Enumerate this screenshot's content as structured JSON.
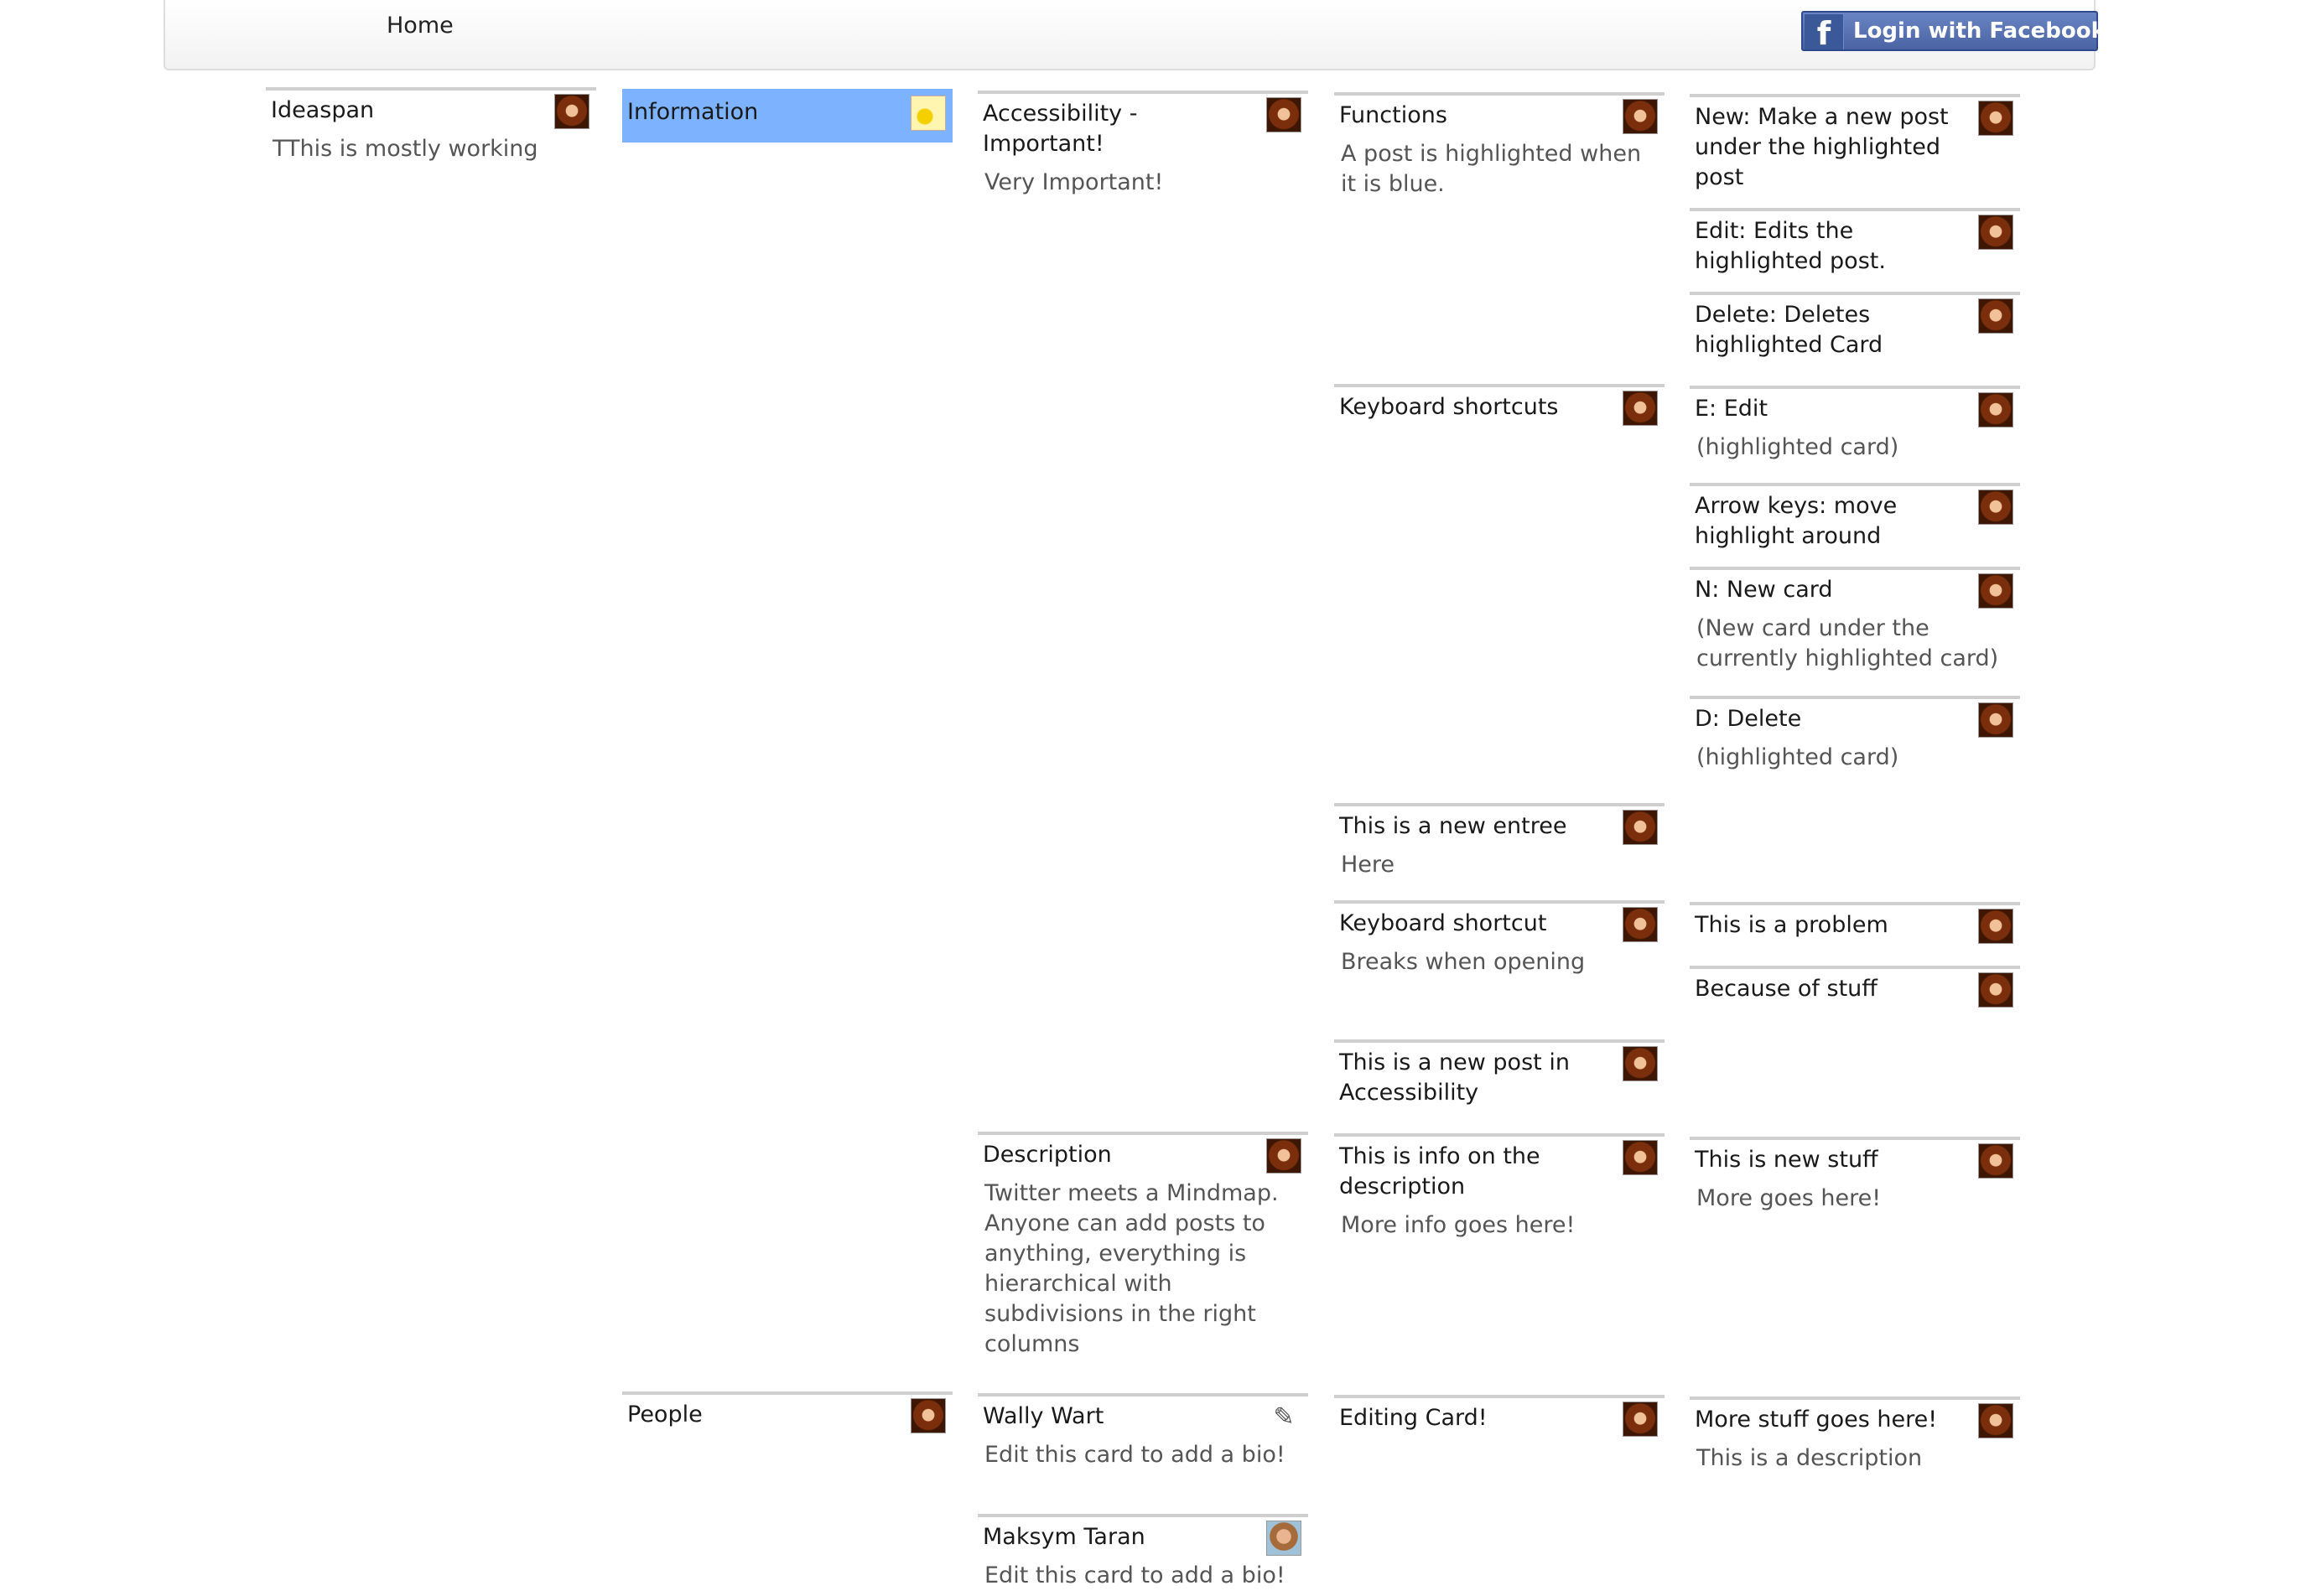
{
  "nav": {
    "home": "Home",
    "login_label": "Login with Facebook",
    "facebook_icon": "facebook-icon"
  },
  "cards": [
    {
      "title": "Ideaspan",
      "description": "TThis is mostly working",
      "avatar": "user-avatar"
    },
    {
      "title": "Information",
      "description": "",
      "avatar": "user-avatar",
      "selected": true
    },
    {
      "title": "Accessibility -\nImportant!",
      "description": "Very Important!",
      "avatar": "user-avatar"
    },
    {
      "title": "Functions",
      "description": "A post is highlighted when\nit is blue.",
      "avatar": "user-avatar"
    },
    {
      "title": "New: Make a new post\nunder the highlighted\npost",
      "description": "",
      "avatar": "user-avatar"
    },
    {
      "title": "Edit: Edits the\nhighlighted post.",
      "description": "",
      "avatar": "user-avatar"
    },
    {
      "title": "Delete: Deletes\nhighlighted Card",
      "description": "",
      "avatar": "user-avatar"
    },
    {
      "title": "Keyboard shortcuts",
      "description": "",
      "avatar": "user-avatar"
    },
    {
      "title": "E: Edit",
      "description": "(highlighted card)",
      "avatar": "user-avatar"
    },
    {
      "title": "Arrow keys: move\nhighlight around",
      "description": "",
      "avatar": "user-avatar"
    },
    {
      "title": "N: New card",
      "description": "(New card under the\ncurrently highlighted card)",
      "avatar": "user-avatar"
    },
    {
      "title": "D: Delete",
      "description": "(highlighted card)",
      "avatar": "user-avatar"
    },
    {
      "title": "This is a new entree",
      "description": "Here",
      "avatar": "user-avatar"
    },
    {
      "title": "Keyboard shortcut",
      "description": "Breaks when opening",
      "avatar": "user-avatar"
    },
    {
      "title": "This is a problem",
      "description": "",
      "avatar": "user-avatar"
    },
    {
      "title": "Because of stuff",
      "description": "",
      "avatar": "user-avatar"
    },
    {
      "title": "This is a new post in\nAccessibility",
      "description": "",
      "avatar": "user-avatar"
    },
    {
      "title": "Description",
      "description": "Twitter meets a Mindmap.\nAnyone can add posts to\nanything, everything is\nhierarchical with\nsubdivisions in the right\ncolumns",
      "avatar": "user-avatar"
    },
    {
      "title": "This is info on the\ndescription",
      "description": "More info goes here!",
      "avatar": "user-avatar"
    },
    {
      "title": "This is new stuff",
      "description": "More goes here!",
      "avatar": "user-avatar"
    },
    {
      "title": "People",
      "description": "",
      "avatar": "user-avatar"
    },
    {
      "title": "Wally Wart",
      "description": "Edit this card to add a bio!",
      "avatar": "sketch-avatar"
    },
    {
      "title": "Editing Card!",
      "description": "",
      "avatar": "user-avatar"
    },
    {
      "title": "More stuff goes here!",
      "description": "This is a description",
      "avatar": "user-avatar"
    },
    {
      "title": "Maksym Taran",
      "description": "Edit this card to add a bio!",
      "avatar": "photo-avatar"
    }
  ]
}
